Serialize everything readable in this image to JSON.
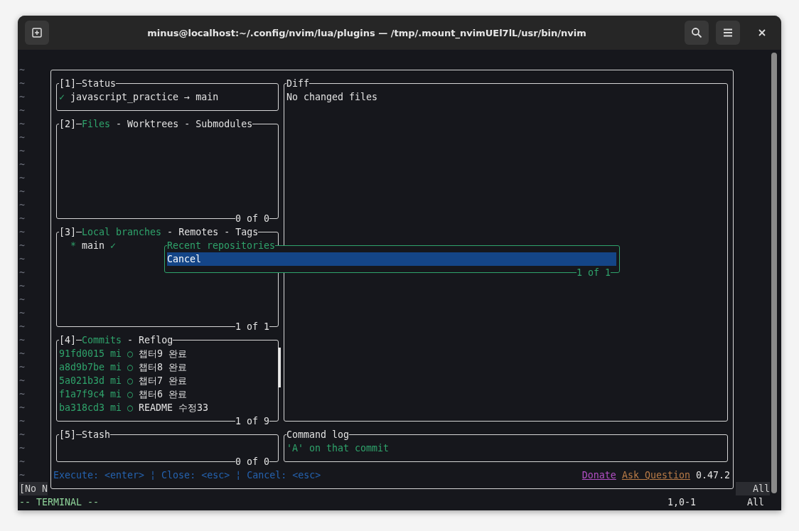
{
  "window": {
    "title": "minus@localhost:~/.config/nvim/lua/plugins — /tmp/.mount_nvimUEl7lL/usr/bin/nvim"
  },
  "tildes": [
    "~",
    "~",
    "~",
    "~",
    "~",
    "~",
    "~",
    "~",
    "~",
    "~",
    "~",
    "~",
    "~",
    "~",
    "~",
    "~",
    "~",
    "~",
    "~",
    "~",
    "~",
    "~",
    "~",
    "~",
    "~",
    "~",
    "~",
    "~",
    "~",
    "~",
    "~"
  ],
  "tab_separator": " - ",
  "panels": [
    {
      "number": "[1]",
      "title": "Status",
      "status": {
        "mark": "✓",
        "text": "javascript_practice → main"
      }
    },
    {
      "number": "[2]",
      "tabs": [
        {
          "label": "Files",
          "selected": true
        },
        {
          "label": "Worktrees",
          "selected": false
        },
        {
          "label": "Submodules",
          "selected": false
        }
      ],
      "footer": "0 of 0"
    },
    {
      "number": "[3]",
      "tabs": [
        {
          "label": "Local branches",
          "selected": true
        },
        {
          "label": "Remotes",
          "selected": false
        },
        {
          "label": "Tags",
          "selected": false
        }
      ],
      "branches": [
        {
          "marker": "*",
          "name": "main",
          "status": "✓"
        }
      ],
      "footer": "1 of 1"
    },
    {
      "number": "[4]",
      "tabs": [
        {
          "label": "Commits",
          "selected": true
        },
        {
          "label": "Reflog",
          "selected": false
        }
      ],
      "commits": [
        {
          "hash": "91fd0015",
          "author": "mi",
          "graph": "○",
          "message": "챕터9 완료"
        },
        {
          "hash": "a8d9b7be",
          "author": "mi",
          "graph": "○",
          "message": "챕터8 완료"
        },
        {
          "hash": "5a021b3d",
          "author": "mi",
          "graph": "○",
          "message": "챕터7 완료"
        },
        {
          "hash": "f1a7f9c4",
          "author": "mi",
          "graph": "○",
          "message": "챕터6 완료"
        },
        {
          "hash": "ba318cd3",
          "author": "mi",
          "graph": "○",
          "message": "README 수정33"
        }
      ],
      "footer": "1 of 9"
    },
    {
      "number": "[5]",
      "title": "Stash",
      "footer": "0 of 0"
    }
  ],
  "diff": {
    "title": "Diff",
    "text": "No changed files"
  },
  "command_log": {
    "title": "Command log",
    "text": "'A' on that commit"
  },
  "popup": {
    "title": "Recent repositories",
    "items": [
      {
        "label": "Cancel",
        "selected": true
      }
    ],
    "footer": "1 of 1"
  },
  "keybindings": "Execute: <enter> ¦ Close: <esc> ¦ Cancel: <esc>",
  "links": [
    {
      "label": "Donate",
      "color": "#b24fc4"
    },
    {
      "label": "Ask Question",
      "color": "#b97b47"
    }
  ],
  "version": "0.47.2",
  "statusline": {
    "buffer": "[No N",
    "position": "All"
  },
  "mode": "-- TERMINAL --",
  "cursor": "1,0-1",
  "scroll": "All"
}
